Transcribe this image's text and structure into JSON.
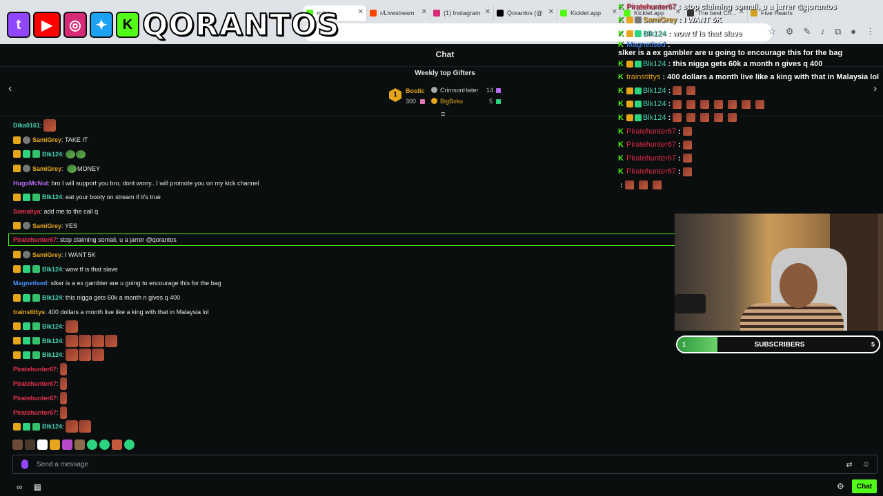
{
  "browser": {
    "tabs": [
      {
        "label": "m/po...",
        "color": "#53fc18",
        "active": true
      },
      {
        "label": "r/Livestream",
        "color": "#ff4500"
      },
      {
        "label": "(1) Instagram",
        "color": "#d62976"
      },
      {
        "label": "Qorantos (@",
        "color": "#000000"
      },
      {
        "label": "Kicklet.app",
        "color": "#53fc18"
      },
      {
        "label": "Kicklet.app",
        "color": "#53fc18"
      },
      {
        "label": "The best Ch...",
        "color": "#333333"
      },
      {
        "label": "Five Hearts",
        "color": "#d0a020"
      }
    ]
  },
  "logo": {
    "name": "QORANTOS",
    "icons": [
      "twitch-icon",
      "youtube-icon",
      "instagram-icon",
      "twitter-icon",
      "kick-icon"
    ]
  },
  "chat": {
    "title": "Chat",
    "gifters_title": "Weekly top Gifters",
    "gifters": {
      "first_rank": "1",
      "first": {
        "name": "Bostic",
        "count": "300"
      },
      "second": {
        "name": "CrimsonHater",
        "count": "14"
      },
      "third": {
        "name": "BigBxku",
        "count": "5"
      }
    },
    "messages": [
      {
        "user": "Dika0161",
        "color": "#46d3b5",
        "badges": [],
        "text": "",
        "emotes": 1
      },
      {
        "user": "SamiGrey",
        "color": "#e5a61c",
        "badges": [
          "crown",
          "gear"
        ],
        "text": "TAKE IT"
      },
      {
        "user": "Blk124",
        "color": "#46d3b5",
        "badges": [
          "crown",
          "green",
          "gift"
        ],
        "text": "",
        "emotes": 2,
        "emote_kind": "green"
      },
      {
        "user": "SamiGrey",
        "color": "#e5a61c",
        "badges": [
          "crown",
          "gear"
        ],
        "text": "MONEY",
        "emotes": 1,
        "emote_kind": "green"
      },
      {
        "user": "HugoMcNut",
        "color": "#b86cf7",
        "badges": [],
        "text": "bro I will support you bro, dont worry.. I will promote you on my kick channel"
      },
      {
        "user": "Blk124",
        "color": "#46d3b5",
        "badges": [
          "crown",
          "green",
          "gift"
        ],
        "text": "eat your booty on stream if it's true"
      },
      {
        "user": "Somaliya",
        "color": "#e5324e",
        "badges": [],
        "text": "add me to the call q"
      },
      {
        "user": "SamiGrey",
        "color": "#e5a61c",
        "badges": [
          "crown",
          "gear"
        ],
        "text": "YES"
      },
      {
        "user": "Piratehunter67",
        "color": "#e5324e",
        "badges": [],
        "text": "stop claiming somali, u a jarrer @qorantos",
        "highlight": true
      },
      {
        "user": "SamiGrey",
        "color": "#e5a61c",
        "badges": [
          "crown",
          "gear"
        ],
        "text": "I WANT 5K"
      },
      {
        "user": "Blk124",
        "color": "#46d3b5",
        "badges": [
          "crown",
          "green",
          "gift"
        ],
        "text": "wow tf is that slave"
      },
      {
        "user": "Magnetised",
        "color": "#4a8ef7",
        "badges": [],
        "text": "slker is a ex gambler are u going to encourage this for the bag"
      },
      {
        "user": "Blk124",
        "color": "#46d3b5",
        "badges": [
          "crown",
          "green",
          "gift"
        ],
        "text": "this nigga gets 60k a month n gives q 400"
      },
      {
        "user": "trainstittys",
        "color": "#e5a61c",
        "badges": [],
        "text": "400 dollars a month live like a king with that in Malaysia lol"
      },
      {
        "user": "Blk124",
        "color": "#46d3b5",
        "badges": [
          "crown",
          "green",
          "gift"
        ],
        "text": "",
        "emotes": 1
      },
      {
        "user": "Blk124",
        "color": "#46d3b5",
        "badges": [
          "crown",
          "green",
          "gift"
        ],
        "text": "",
        "emotes": 4
      },
      {
        "user": "Blk124",
        "color": "#46d3b5",
        "badges": [
          "crown",
          "green",
          "gift"
        ],
        "text": "",
        "emotes": 3
      },
      {
        "user": "Piratehunter67",
        "color": "#e5324e",
        "badges": [],
        "text": "",
        "emotes": 1,
        "emote_kind": "small"
      },
      {
        "user": "Piratehunter67",
        "color": "#e5324e",
        "badges": [],
        "text": "",
        "emotes": 1,
        "emote_kind": "small"
      },
      {
        "user": "Piratehunter67",
        "color": "#e5324e",
        "badges": [],
        "text": "",
        "emotes": 1,
        "emote_kind": "small"
      },
      {
        "user": "Piratehunter67",
        "color": "#e5324e",
        "badges": [],
        "text": "",
        "emotes": 1,
        "emote_kind": "small"
      },
      {
        "user": "Blk124",
        "color": "#46d3b5",
        "badges": [
          "crown",
          "green",
          "gift"
        ],
        "text": "",
        "emotes": 2
      }
    ],
    "emote_bar": [
      "#6b4a3a",
      "#4a3a2e",
      "#ffffff",
      "#e5a61c",
      "#b84ac9",
      "#8a6a4a",
      "#2dd47f",
      "#2dd47f",
      "#c45a3c",
      "#2dd47f"
    ],
    "input_placeholder": "Send a message",
    "chat_button": "Chat"
  },
  "overlay": {
    "lines": [
      {
        "user": "Piratehunter67",
        "color": "#e5324e",
        "text": "stop claiming somali, u a jarrer @qorantos",
        "badges": []
      },
      {
        "user": "SamiGrey",
        "color": "#e5a61c",
        "text": "I WANT 5K",
        "badges": [
          "#e5a61c",
          "#777777"
        ]
      },
      {
        "user": "Blk124",
        "color": "#46d3b5",
        "text": "wow tf is that slave",
        "badges": [
          "#e5a61c",
          "#2dd47f"
        ]
      },
      {
        "user": "Magnetised",
        "color": "#4a8ef7",
        "text": "slker is a ex gambler are u going to encourage this for the bag",
        "badges": []
      },
      {
        "user": "Blk124",
        "color": "#46d3b5",
        "text": "this nigga gets 60k a month n gives q 400",
        "badges": [
          "#e5a61c",
          "#2dd47f"
        ]
      },
      {
        "user": "trainstittys",
        "color": "#e5a61c",
        "text": "400 dollars a month live like a king with that in Malaysia lol",
        "badges": []
      },
      {
        "user": "Blk124",
        "color": "#46d3b5",
        "text": "",
        "badges": [
          "#e5a61c",
          "#2dd47f"
        ],
        "emotes": 2
      },
      {
        "user": "Blk124",
        "color": "#46d3b5",
        "text": "",
        "badges": [
          "#e5a61c",
          "#2dd47f"
        ],
        "emotes": 7
      },
      {
        "user": "Blk124",
        "color": "#46d3b5",
        "text": "",
        "badges": [
          "#e5a61c",
          "#2dd47f"
        ],
        "emotes": 5
      },
      {
        "user": "Piratehunter67",
        "color": "#e5324e",
        "text": "",
        "badges": [],
        "emotes": 1
      },
      {
        "user": "Piratehunter67",
        "color": "#e5324e",
        "text": "",
        "badges": [],
        "emotes": 1
      },
      {
        "user": "Piratehunter67",
        "color": "#e5324e",
        "text": "",
        "badges": [],
        "emotes": 1
      },
      {
        "user": "Piratehunter67",
        "color": "#e5324e",
        "text": "",
        "badges": [],
        "emotes": 1
      },
      {
        "user": "",
        "color": "#ffffff",
        "text": "",
        "badges": [],
        "emotes": 3,
        "no_k": true
      }
    ]
  },
  "subs": {
    "label": "SUBSCRIBERS",
    "current": "1",
    "goal": "5",
    "progress": 0.2
  }
}
